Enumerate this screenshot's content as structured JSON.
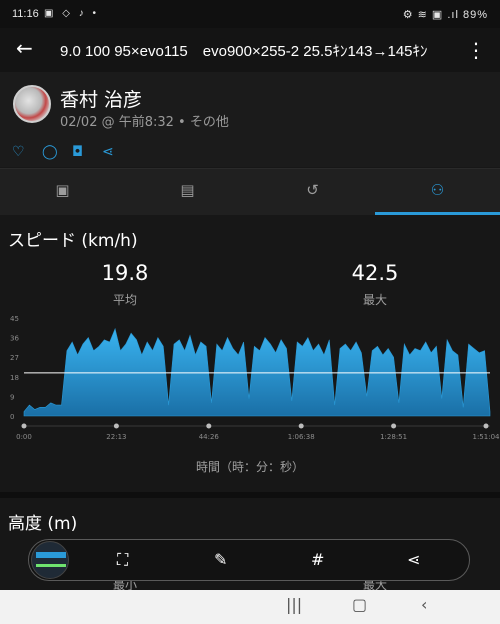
{
  "status_bar": {
    "time": "11:16",
    "notification_icons": "▣ ◇ ♪ •",
    "right_icons": "⚙ ≋ ▣ .ıl 89%"
  },
  "app_bar": {
    "back_icon": "←",
    "title": "9.0 100 95×evo115　evo900×255-2 25.5ｷﾝ143→145ｷﾝ",
    "more_icon": "⋮"
  },
  "activity": {
    "user_name": "香村 治彦",
    "meta": "02/02 @ 午前8:32 • その他"
  },
  "actions": {
    "like_icon": "♡",
    "comment_icon": "◯",
    "camera_icon": "◘",
    "share_icon": "⋖"
  },
  "tabs": [
    {
      "name": "summary",
      "icon": "▣",
      "active": false
    },
    {
      "name": "details",
      "icon": "▤",
      "active": false
    },
    {
      "name": "laps",
      "icon": "↺",
      "active": false
    },
    {
      "name": "charts",
      "icon": "⚇",
      "active": true
    }
  ],
  "speed_section": {
    "title": "スピード (km/h)",
    "avg_value": "19.8",
    "avg_label": "平均",
    "max_value": "42.5",
    "max_label": "最大",
    "x_axis_label": "時間（時：分：秒）"
  },
  "chart_data": {
    "type": "area",
    "y_ticks": [
      "45",
      "36",
      "27",
      "18",
      "9",
      "0"
    ],
    "x_ticks": [
      "0:00",
      "22:13",
      "44:26",
      "1:06:38",
      "1:28:51",
      "1:51:04"
    ],
    "ylim": [
      0,
      45
    ],
    "average_line": 19.8,
    "values": [
      2,
      5,
      3,
      4,
      4,
      6,
      5,
      5,
      30,
      34,
      28,
      33,
      36,
      30,
      32,
      35,
      34,
      40,
      30,
      33,
      38,
      35,
      28,
      34,
      30,
      36,
      32,
      5,
      33,
      35,
      30,
      37,
      28,
      34,
      32,
      6,
      33,
      30,
      36,
      31,
      28,
      34,
      8,
      32,
      30,
      36,
      33,
      29,
      35,
      31,
      7,
      34,
      32,
      36,
      30,
      33,
      28,
      35,
      5,
      31,
      33,
      30,
      34,
      29,
      9,
      30,
      32,
      28,
      31,
      27,
      6,
      33,
      28,
      31,
      30,
      34,
      29,
      32,
      8,
      35,
      30,
      28,
      4,
      33,
      31,
      29,
      30,
      2
    ],
    "color": "#2a9ad8"
  },
  "altitude_section": {
    "title": "高度 (m)",
    "min_label": "最小",
    "max_label": "最大"
  },
  "toolbar": {
    "crop_icon": "⛶",
    "edit_icon": "✎",
    "hash_icon": "#",
    "share_icon": "⋖"
  },
  "nav_bar": {
    "recents_icon": "|||",
    "home_icon": "▢",
    "back_icon": "‹"
  }
}
